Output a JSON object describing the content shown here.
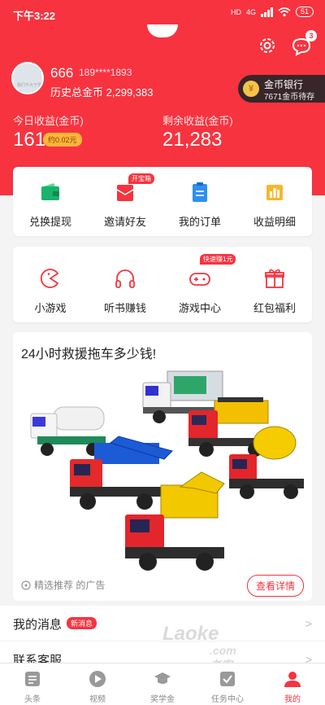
{
  "status": {
    "time": "下午3:22",
    "net": "4G",
    "hd": "HD",
    "battery": "51"
  },
  "header": {
    "message_count": "3"
  },
  "user": {
    "avatar_caption": "我们不大于零",
    "name": "666",
    "phone": "189****1893",
    "history_label": "历史总金币",
    "history_value": "2,299,383"
  },
  "bank": {
    "title": "金币银行",
    "pending": "7671金币待存"
  },
  "stats": {
    "today_label": "今日收益(金币)",
    "today_value": "161",
    "today_approx": "约0.02元",
    "remain_label": "剩余收益(金币)",
    "remain_value": "21,283"
  },
  "grid1": [
    {
      "label": "兑换提现",
      "icon": "wallet-icon",
      "tag": ""
    },
    {
      "label": "邀请好友",
      "icon": "envelope-icon",
      "tag": "开宝箱"
    },
    {
      "label": "我的订单",
      "icon": "clipboard-icon",
      "tag": ""
    },
    {
      "label": "收益明细",
      "icon": "bar-chart-icon",
      "tag": ""
    }
  ],
  "grid2": [
    {
      "label": "小游戏",
      "icon": "pacman-icon",
      "tag": ""
    },
    {
      "label": "听书赚钱",
      "icon": "headphones-icon",
      "tag": ""
    },
    {
      "label": "游戏中心",
      "icon": "gamepad-icon",
      "tag": "快速赚1元"
    },
    {
      "label": "红包福利",
      "icon": "gift-icon",
      "tag": ""
    }
  ],
  "ad": {
    "title": "24小时救援拖车多少钱!",
    "source": "精选推荐 的广告",
    "button": "查看详情"
  },
  "menu": [
    {
      "label": "我的消息",
      "badge": "新消息"
    },
    {
      "label": "联系客服",
      "badge": ""
    }
  ],
  "watermark": {
    "brand": "Laoke",
    "sub": ".com老客"
  },
  "tabs": [
    {
      "label": "头条",
      "active": false
    },
    {
      "label": "视频",
      "active": false
    },
    {
      "label": "奖学金",
      "active": false
    },
    {
      "label": "任务中心",
      "active": false
    },
    {
      "label": "我的",
      "active": true
    }
  ],
  "colors": {
    "primary": "#f7333f",
    "bank_bg": "#38262a",
    "coin": "#f5c24a"
  }
}
